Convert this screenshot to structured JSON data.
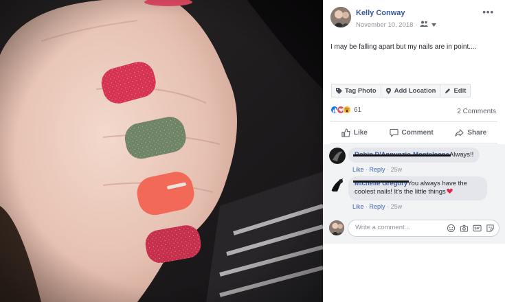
{
  "post": {
    "author": "Kelly Conway",
    "date": "November 10, 2018",
    "date_separator": "·",
    "audience_icon": "friends-icon",
    "more_label": "•••",
    "caption": "I may be falling apart but my nails are in point...."
  },
  "photo_actions": [
    {
      "label": "Tag Photo",
      "icon": "tag-icon"
    },
    {
      "label": "Add Location",
      "icon": "location-pin-icon"
    },
    {
      "label": "Edit",
      "icon": "pencil-icon"
    }
  ],
  "reactions": {
    "types": [
      "like-reaction-icon",
      "love-reaction-icon",
      "wow-reaction-icon"
    ],
    "count": "61",
    "comments_count": "2 Comments"
  },
  "buttons": {
    "like": "Like",
    "comment": "Comment",
    "share": "Share"
  },
  "comments": [
    {
      "author": "Robin D'Annunzio-Monteleone",
      "text": "Always!!",
      "like": "Like",
      "reply": "Reply",
      "time": "25w",
      "separator": "·"
    },
    {
      "author": "Michelle Gregory",
      "text_line1": "You always have the",
      "text_line2": "coolest nails! It's the little things",
      "like": "Like",
      "reply": "Reply",
      "time": "25w",
      "separator": "·"
    }
  ],
  "composer": {
    "placeholder": "Write a comment...",
    "icons": [
      "emoji-icon",
      "camera-icon",
      "gif-icon",
      "sticker-icon"
    ]
  },
  "colors": {
    "link": "#385898",
    "like_blue": "#1877f2",
    "love_red": "#f33e58",
    "wow_yellow": "#f7b125"
  }
}
